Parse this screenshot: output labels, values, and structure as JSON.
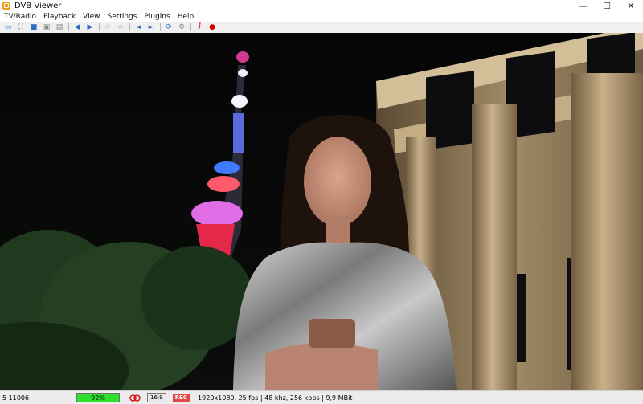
{
  "window": {
    "title": "DVB Viewer",
    "minimize": "—",
    "maximize": "☐",
    "close": "✕"
  },
  "menu": {
    "items": [
      "TV/Radio",
      "Playback",
      "View",
      "Settings",
      "Plugins",
      "Help"
    ]
  },
  "toolbar": {
    "buttons": [
      {
        "name": "screenshot-icon",
        "glyph": "▭",
        "color": "#3a7bd5"
      },
      {
        "name": "fullscreen-icon",
        "glyph": "⛶",
        "color": "#2f6fbf"
      },
      {
        "name": "window-mode-icon",
        "glyph": "■",
        "color": "#2f6fbf"
      },
      {
        "name": "osd-icon",
        "glyph": "▣",
        "color": "#8a8a8a"
      },
      {
        "name": "epg-icon",
        "glyph": "▤",
        "color": "#8a8a8a"
      },
      {
        "name": "back-icon",
        "glyph": "◀",
        "color": "#2c66c4"
      },
      {
        "name": "forward-icon",
        "glyph": "▶",
        "color": "#2c66c4"
      },
      {
        "name": "favorite-icon",
        "glyph": "☆",
        "color": "#9a9a9a"
      },
      {
        "name": "favorite-add-icon",
        "glyph": "☆",
        "color": "#9a9a9a"
      },
      {
        "name": "volume-down-icon",
        "glyph": "◄",
        "color": "#2c66c4"
      },
      {
        "name": "volume-up-icon",
        "glyph": "◄",
        "color": "#2c66c4"
      },
      {
        "name": "refresh-icon",
        "glyph": "⟳",
        "color": "#2c66c4"
      },
      {
        "name": "settings-icon",
        "glyph": "⚙",
        "color": "#8a8a8a"
      },
      {
        "name": "info-icon",
        "glyph": "i",
        "color": "#d0282c"
      },
      {
        "name": "record-icon",
        "glyph": "●",
        "color": "#d40000"
      }
    ]
  },
  "status": {
    "channel": "5 11006",
    "signal_percent": 92,
    "signal_label": "92%",
    "aspect_label": "16:9",
    "rec_label": "REC",
    "stream_info": "1920x1080, 25 fps | 48 khz, 256 kbps | 9,9 MBit",
    "signal_color": "#2ee02e",
    "rec_color": "#e04848"
  }
}
